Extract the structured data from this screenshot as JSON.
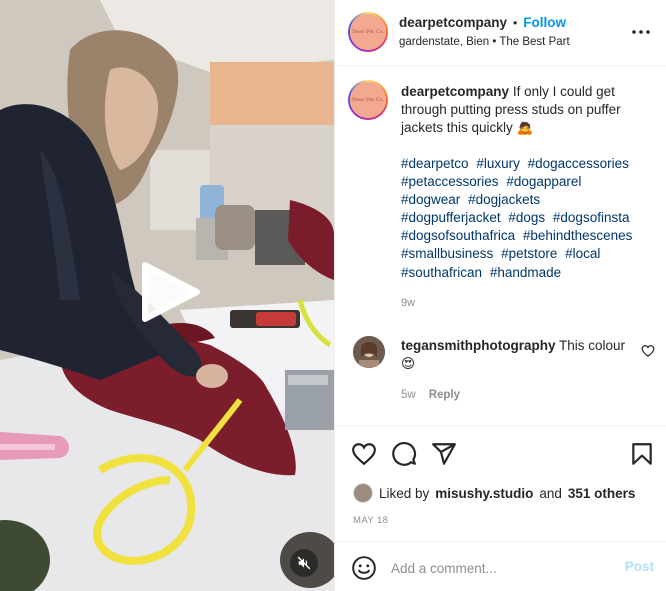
{
  "post": {
    "username": "dearpetcompany",
    "follow_label": "Follow",
    "location": "gardenstate, Bien • The Best Part",
    "avatar_text": "Dear Pet Co."
  },
  "caption": {
    "username": "dearpetcompany",
    "text": "If only I could get through putting press studs on puffer jackets this quickly 🙇",
    "hashtags": [
      "#dearpetco",
      "#luxury",
      "#dogaccessories",
      "#petaccessories",
      "#dogapparel",
      "#dogwear",
      "#dogjackets",
      "#dogpufferjacket",
      "#dogs",
      "#dogsofinsta",
      "#dogsofsouthafrica",
      "#behindthescenes",
      "#smallbusiness",
      "#petstore",
      "#local",
      "#southafrican",
      "#handmade"
    ],
    "time": "9w"
  },
  "comments": [
    {
      "username": "tegansmithphotography",
      "text": "This colour 😍",
      "time": "5w",
      "reply_label": "Reply"
    }
  ],
  "likes": {
    "prefix": "Liked by",
    "liker": "misushy.studio",
    "joiner": "and",
    "others": "351 others"
  },
  "date": "MAY 18",
  "add_comment": {
    "placeholder": "Add a comment...",
    "post_label": "Post"
  },
  "icons": {
    "more": "more-horizontal-icon",
    "like": "heart-icon",
    "comment": "comment-bubble-icon",
    "share": "paper-plane-icon",
    "save": "bookmark-icon",
    "emoji": "smiley-icon",
    "play": "play-icon",
    "mute": "speaker-muted-icon"
  },
  "colors": {
    "accent": "#0095f6",
    "hashtag": "#00376b",
    "muted": "#8e8e8e",
    "post_disabled": "#b2dffc"
  }
}
